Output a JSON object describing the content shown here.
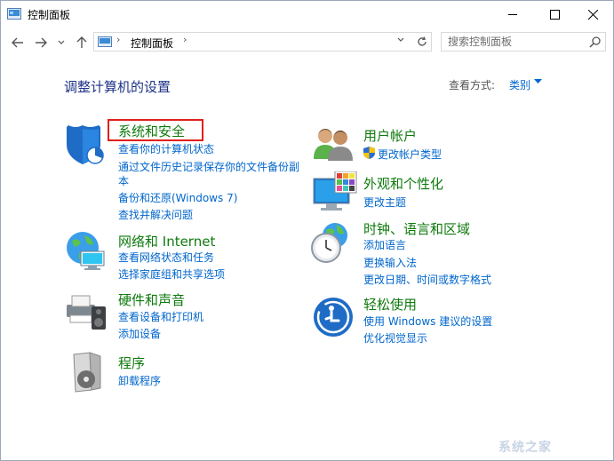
{
  "window": {
    "title": "控制面板"
  },
  "address": {
    "crumb": "控制面板",
    "separator": "›"
  },
  "search": {
    "placeholder": "搜索控制面板"
  },
  "heading": {
    "title": "调整计算机的设置",
    "view_label": "查看方式:",
    "view_value": "类别"
  },
  "categories_left": [
    {
      "title": "系统和安全",
      "links": [
        "查看你的计算机状态",
        "通过文件历史记录保存你的文件备份副",
        "本",
        "备份和还原(Windows 7)",
        "查找并解决问题"
      ]
    },
    {
      "title": "网络和 Internet",
      "links": [
        "查看网络状态和任务",
        "选择家庭组和共享选项"
      ]
    },
    {
      "title": "硬件和声音",
      "links": [
        "查看设备和打印机",
        "添加设备"
      ]
    },
    {
      "title": "程序",
      "links": [
        "卸载程序"
      ]
    }
  ],
  "categories_right": [
    {
      "title": "用户帐户",
      "links": [
        "更改帐户类型"
      ]
    },
    {
      "title": "外观和个性化",
      "links": [
        "更改主题"
      ]
    },
    {
      "title": "时钟、语言和区域",
      "links": [
        "添加语言",
        "更换输入法",
        "更改日期、时间或数字格式"
      ]
    },
    {
      "title": "轻松使用",
      "links": [
        "使用 Windows 建议的设置",
        "优化视觉显示"
      ]
    }
  ],
  "watermark": "系统之家",
  "colors": {
    "link": "#0066cc",
    "category_title": "#0e7a0d",
    "heading": "#1e3287",
    "highlight": "#e0201b"
  }
}
